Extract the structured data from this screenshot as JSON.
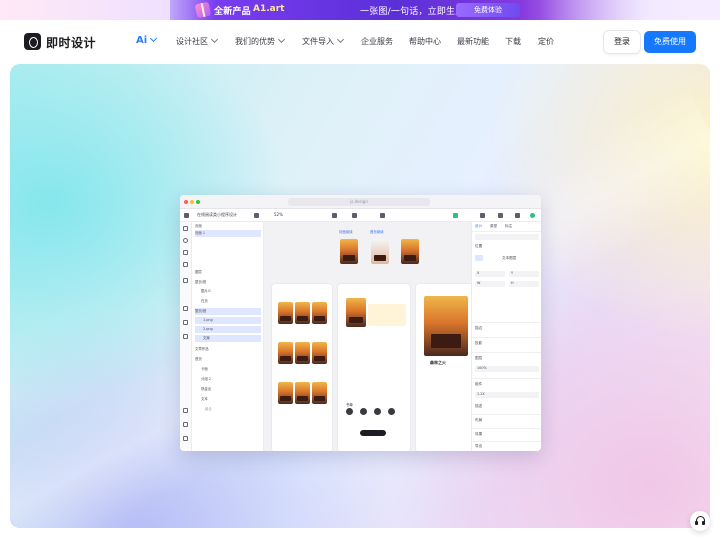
{
  "promo": {
    "title": "全新产品",
    "app_name": "A1.art",
    "slogan": "一张图/一句话，立即生成高质量图像",
    "cta": "免费体验"
  },
  "nav": {
    "brand": "即时设计",
    "items": [
      {
        "label": "Ai",
        "has_dropdown": true
      },
      {
        "label": "设计社区",
        "has_dropdown": true
      },
      {
        "label": "我们的优势",
        "has_dropdown": true
      },
      {
        "label": "文件导入",
        "has_dropdown": true
      },
      {
        "label": "企业服务",
        "has_dropdown": false
      },
      {
        "label": "帮助中心",
        "has_dropdown": false
      },
      {
        "label": "最新功能",
        "has_dropdown": false
      },
      {
        "label": "下载",
        "has_dropdown": false
      },
      {
        "label": "定价",
        "has_dropdown": false
      }
    ],
    "login": "登录",
    "signup": "免费使用"
  },
  "app_preview": {
    "url": "js.design",
    "file_name": "在线阅读类小程序设计",
    "zoom": "52%",
    "layer_panel_label": "页面",
    "layers": [
      "页面 1",
      "图层",
      "整页/首",
      "图片/1",
      "在页",
      "整页/首",
      "1.png",
      "2.png",
      "文案",
      "文章作品",
      "首页",
      "卡面",
      "分组 2",
      "现金出",
      "文本",
      "组合"
    ],
    "canvas_labels": [
      "封面阅读",
      "首页阅读",
      "1.png",
      "书单",
      "分类"
    ],
    "book_title": "森林之火",
    "props_tabs": [
      "设计",
      "原型",
      "标注"
    ],
    "props_labels": [
      "位置",
      "文本图层",
      "描边",
      "投影",
      "图层",
      "组件",
      "描述",
      "布局",
      "效果",
      "导出"
    ],
    "props_values": [
      "X",
      "Y",
      "W",
      "H",
      "100%",
      "1.2X"
    ]
  },
  "colors": {
    "accent": "#1677ff",
    "ai_link": "#2b7cff",
    "promo_purple": "#5b2fd8",
    "brand_dark": "#1c1c22"
  },
  "icons": [
    "gift-icon",
    "brand-logo-icon",
    "chevron-down-icon",
    "headset-icon"
  ]
}
